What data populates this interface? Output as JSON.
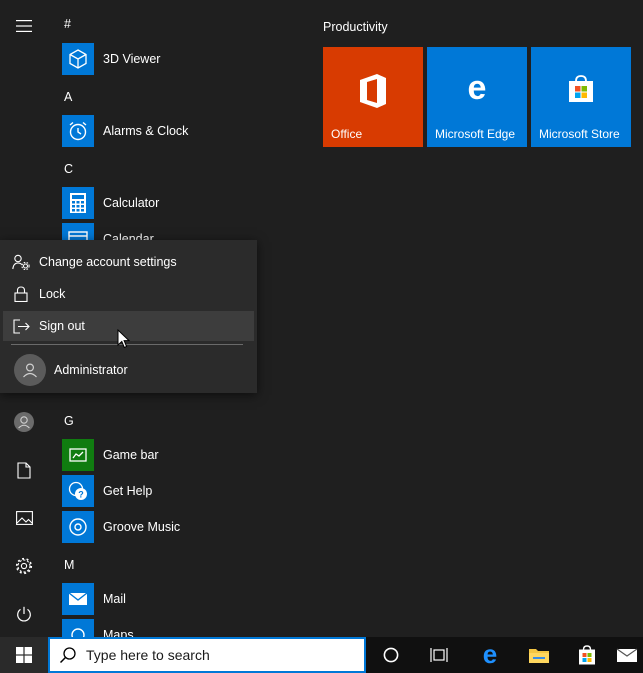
{
  "app_list": {
    "headers": {
      "hash": "#",
      "a": "A",
      "c": "C",
      "g": "G",
      "m": "M"
    },
    "apps": {
      "viewer3d": "3D Viewer",
      "alarms": "Alarms & Clock",
      "calculator": "Calculator",
      "calendar": "Calendar",
      "gamebar": "Game bar",
      "gethelp": "Get Help",
      "groove": "Groove Music",
      "mail": "Mail",
      "maps": "Maps"
    }
  },
  "tiles": {
    "group_title": "Productivity",
    "office": "Office",
    "edge": "Microsoft Edge",
    "store": "Microsoft Store"
  },
  "account_menu": {
    "change_settings": "Change account settings",
    "lock": "Lock",
    "sign_out": "Sign out",
    "user": "Administrator"
  },
  "taskbar": {
    "search_placeholder": "Type here to search"
  },
  "colors": {
    "accent": "#0078d7",
    "office_tile": "#d83b01",
    "edge_tile": "#0078d7",
    "store_tile": "#0078d7",
    "gamebar_icon": "#107c10"
  }
}
